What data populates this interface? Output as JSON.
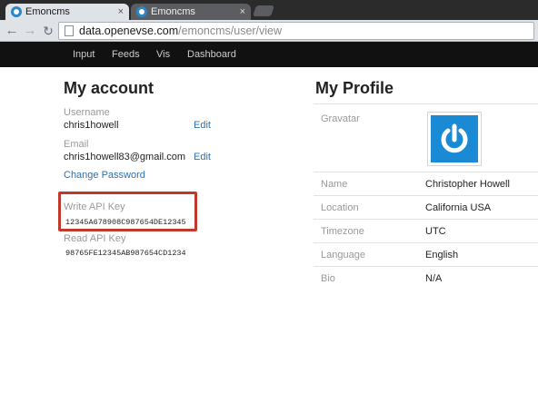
{
  "browser": {
    "tabs": [
      {
        "title": "Emoncms",
        "active": true
      },
      {
        "title": "Emoncms",
        "active": false
      }
    ],
    "tab_close_glyph": "×",
    "url_host": "data.openevse.com",
    "url_path": "/emoncms/user/view"
  },
  "nav": {
    "items": [
      "Input",
      "Feeds",
      "Vis",
      "Dashboard"
    ]
  },
  "account": {
    "title": "My account",
    "username_label": "Username",
    "username_value": "chris1howell",
    "email_label": "Email",
    "email_value": "chris1howell83@gmail.com",
    "edit_label": "Edit",
    "change_password_label": "Change Password",
    "write_api_key_label": "Write API Key",
    "write_api_key_value": "12345A678908C987654DE12345",
    "read_api_key_label": "Read API Key",
    "read_api_key_value": "98765FE12345AB987654CD1234"
  },
  "profile": {
    "title": "My Profile",
    "gravatar_label": "Gravatar",
    "rows": [
      {
        "label": "Name",
        "value": "Christopher Howell"
      },
      {
        "label": "Location",
        "value": "California USA"
      },
      {
        "label": "Timezone",
        "value": "UTC"
      },
      {
        "label": "Language",
        "value": "English"
      },
      {
        "label": "Bio",
        "value": "N/A"
      }
    ]
  },
  "colors": {
    "accent_link": "#2b72b0",
    "highlight_border": "#c0392b",
    "gravatar_blue": "#1a8ad4",
    "nav_background": "#111111"
  },
  "icons": {
    "back": "arrow-left-icon",
    "forward": "arrow-right-icon",
    "reload": "reload-icon",
    "page": "page-icon",
    "gravatar": "power-symbol-icon"
  }
}
